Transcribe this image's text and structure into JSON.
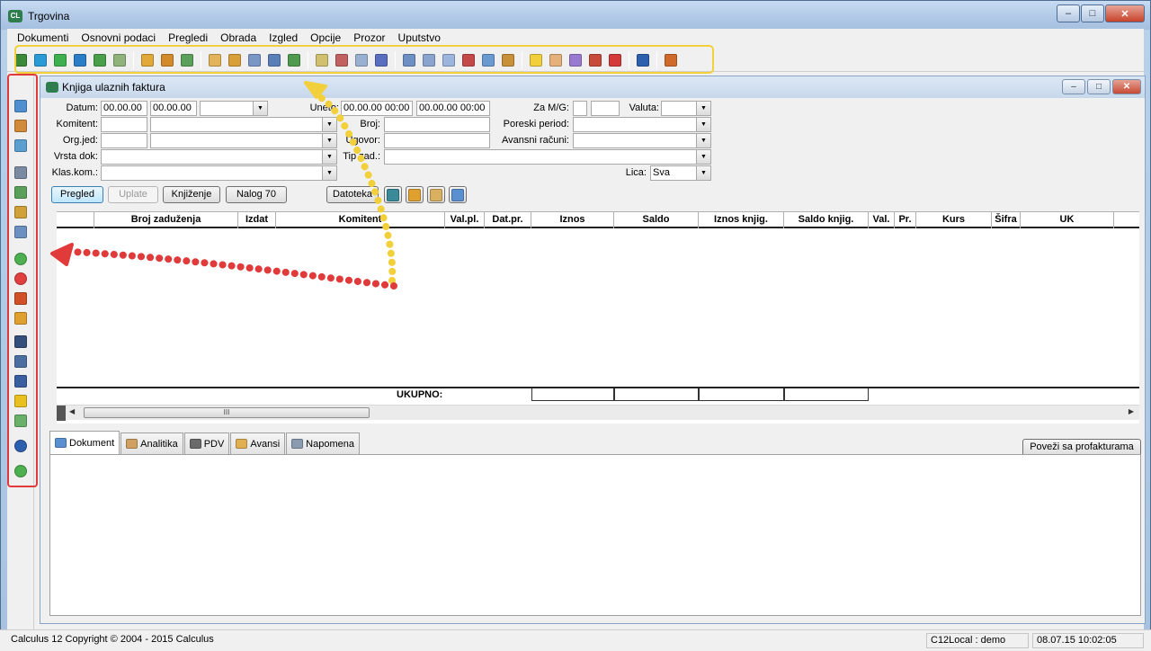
{
  "window": {
    "title": "Trgovina",
    "min": "–",
    "max": "□",
    "close": "✕"
  },
  "menu": [
    "Dokumenti",
    "Osnovni podaci",
    "Pregledi",
    "Obrada",
    "Izgled",
    "Opcije",
    "Prozor",
    "Uputstvo"
  ],
  "toolbar_icons": [
    {
      "name": "first-record-icon",
      "color": "#3a8a3a"
    },
    {
      "name": "prev-record-icon",
      "color": "#2a9bd6"
    },
    {
      "name": "refresh-icon",
      "color": "#3fb04f"
    },
    {
      "name": "next-record-icon",
      "color": "#2a7dc6"
    },
    {
      "name": "export-icon",
      "color": "#4aa04a"
    },
    {
      "name": "document-icon",
      "color": "#8fb37a"
    },
    {
      "name": "import-icon",
      "color": "#e0a93a"
    },
    {
      "name": "move-icon",
      "color": "#d38a2a"
    },
    {
      "name": "forward-icon",
      "color": "#5aa05a"
    },
    {
      "name": "mail-icon",
      "color": "#e3b35a"
    },
    {
      "name": "edit-icon",
      "color": "#d9a03a"
    },
    {
      "name": "new-doc-icon",
      "color": "#7a96c6"
    },
    {
      "name": "save-icon",
      "color": "#5a7fb8"
    },
    {
      "name": "save-green-icon",
      "color": "#4f9a4f"
    },
    {
      "name": "copy-icon",
      "color": "#d0c070"
    },
    {
      "name": "paste-icon",
      "color": "#c06060"
    },
    {
      "name": "sum-icon",
      "color": "#9ab0d0"
    },
    {
      "name": "table-icon",
      "color": "#5a6fc0"
    },
    {
      "name": "columns-icon",
      "color": "#6e8fc4"
    },
    {
      "name": "grid-icon",
      "color": "#8aa4d0"
    },
    {
      "name": "windows-icon",
      "color": "#9bb5dc"
    },
    {
      "name": "report-icon",
      "color": "#c44a4a"
    },
    {
      "name": "chart-icon",
      "color": "#6a9ad0"
    },
    {
      "name": "book-icon",
      "color": "#c8903a"
    },
    {
      "name": "bulb-icon",
      "color": "#f2d03b"
    },
    {
      "name": "tag-icon",
      "color": "#e6b07a"
    },
    {
      "name": "settings-icon",
      "color": "#9a7ad0"
    },
    {
      "name": "calculator-icon",
      "color": "#c84a3a"
    },
    {
      "name": "gem-icon",
      "color": "#d43a3a"
    },
    {
      "name": "help-icon",
      "color": "#2c5fae"
    },
    {
      "name": "exit-icon",
      "color": "#d06a2a"
    }
  ],
  "left_toolbar_icons": [
    {
      "name": "save-icon",
      "color": "#4f8fcf"
    },
    {
      "name": "save-all-icon",
      "color": "#d08a3a"
    },
    {
      "name": "save-copy-icon",
      "color": "#5a9fd0"
    },
    {
      "name": "print-icon",
      "color": "#7a8aa0"
    },
    {
      "name": "print-preview-icon",
      "color": "#5a9f5a"
    },
    {
      "name": "people-icon",
      "color": "#d0a03a"
    },
    {
      "name": "attachment-icon",
      "color": "#6a8fc0"
    },
    {
      "name": "add-icon",
      "color": "#4caf50"
    },
    {
      "name": "remove-icon",
      "color": "#e04040"
    },
    {
      "name": "undo-icon",
      "color": "#d0502a"
    },
    {
      "name": "edit-icon",
      "color": "#e0a030"
    },
    {
      "name": "find-icon",
      "color": "#334f7a"
    },
    {
      "name": "find-next-icon",
      "color": "#4a6fa0"
    },
    {
      "name": "sort-icon",
      "color": "#3a5fa0"
    },
    {
      "name": "filter-icon",
      "color": "#e8c020"
    },
    {
      "name": "collapse-icon",
      "color": "#6ab06a"
    },
    {
      "name": "help-icon",
      "color": "#2c5fae"
    },
    {
      "name": "go-icon",
      "color": "#4caf50"
    }
  ],
  "child": {
    "title": "Knjiga ulaznih faktura",
    "min": "–",
    "max": "□",
    "close": "✕"
  },
  "form": {
    "datum_label": "Datum:",
    "datum_from": "00.00.00",
    "datum_to": "00.00.00",
    "uneto_label": "Uneto:",
    "uneto_from": "00.00.00 00:00",
    "uneto_to": "00.00.00 00:00",
    "zamg_label": "Za M/G:",
    "valuta_label": "Valuta:",
    "komitent_label": "Komitent:",
    "broj_label": "Broj:",
    "poreski_label": "Poreski period:",
    "orgjed_label": "Org.jed:",
    "ugovor_label": "Ugovor:",
    "avansni_label": "Avansni računi:",
    "vrsta_label": "Vrsta dok:",
    "tipzad_label": "Tip zad.:",
    "klas_label": "Klas.kom.:",
    "lica_label": "Lica:",
    "lica_value": "Sva"
  },
  "buttons": {
    "pregled": "Pregled",
    "uplate": "Uplate",
    "knjizenje": "Knjiženje",
    "nalog": "Nalog 70",
    "datoteka": "Datoteka",
    "povezi": "Poveži sa profakturama"
  },
  "grid": {
    "columns": [
      "",
      "Broj zaduženja",
      "Izdat",
      "Komitent",
      "Val.pl.",
      "Dat.pr.",
      "Iznos",
      "Saldo",
      "Iznos knjig.",
      "Saldo knjig.",
      "Val.",
      "Pr.",
      "Kurs",
      "Šifra",
      "UK"
    ],
    "rows": [],
    "total_label": "UKUPNO:",
    "scroll_thumb": "III"
  },
  "tabs": [
    {
      "label": "Dokument",
      "icon": "document-icon",
      "active": true
    },
    {
      "label": "Analitika",
      "icon": "calculator-icon",
      "active": false
    },
    {
      "label": "PDV",
      "icon": "percent-icon",
      "active": false
    },
    {
      "label": "Avansi",
      "icon": "folder-icon",
      "active": false
    },
    {
      "label": "Napomena",
      "icon": "note-icon",
      "active": false
    }
  ],
  "status": {
    "copyright": "Calculus 12  Copyright © 2004 - 2015  Calculus",
    "db": "C12Local : demo",
    "datetime": "08.07.15 10:02:05"
  },
  "colors": {
    "highlight_toolbar": "#f2d03b",
    "highlight_left": "#e03a3a",
    "annotation_yellow": "#f2d03b",
    "annotation_red": "#e03a3a"
  }
}
